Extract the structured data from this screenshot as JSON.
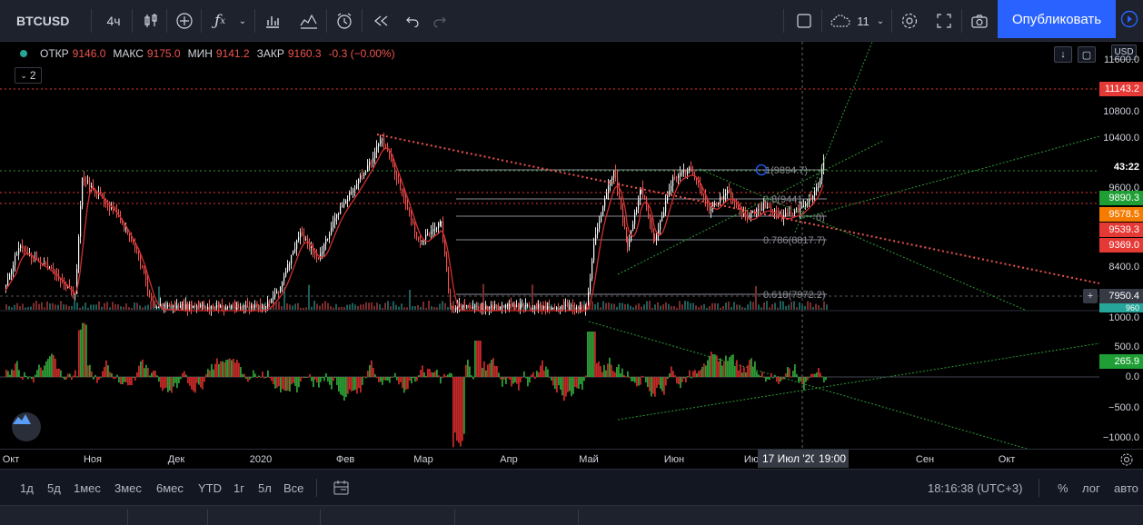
{
  "toolbar": {
    "symbol": "BTCUSD",
    "interval": "4ч",
    "layouts_count": "11",
    "publish_label": "Опубликовать",
    "icons": [
      "candles-icon",
      "add-indicator-icon",
      "fx-icon",
      "chevron-down-icon",
      "compare-icon",
      "bars-icon",
      "alert-icon",
      "replay-icon",
      "undo-icon",
      "redo-icon",
      "layout-icon",
      "cloud-icon",
      "settings-icon",
      "fullscreen-icon",
      "camera-icon",
      "play-icon"
    ]
  },
  "legend": {
    "open_label": "ОТКР",
    "open": "9146.0",
    "high_label": "МАКС",
    "high": "9175.0",
    "low_label": "МИН",
    "low": "9141.2",
    "close_label": "ЗАКР",
    "close": "9160.3",
    "change": "-0.3 (−0.00%)",
    "collapse_count": "2",
    "currency": "USD"
  },
  "colors": {
    "up": "#26a69a",
    "down": "#ef5350",
    "green_ind": "#2e9c35",
    "red_ind": "#c62828",
    "accent": "#2962ff"
  },
  "price_axis": [
    "11600.0",
    "10800.0",
    "10400.0",
    "9600.0",
    "8400.0",
    "1000.0",
    "500.0",
    "0.0",
    "−500.0",
    "−1000.0"
  ],
  "price_tags": {
    "p11143": "11143.2",
    "countdown": "43:22",
    "p9890": "9890.3",
    "p9578": "9578.5",
    "p9539": "9539.3",
    "p9369": "9369.0",
    "p7950": "7950.4",
    "p960": "960",
    "ind_value": "265.9"
  },
  "fib_labels": {
    "f1": "1(9894.7)",
    "f2": "0.8(9441",
    "f3": "0.786(8817.7)",
    "f4": "0.618(7972.2)",
    "f5": "0)"
  },
  "time_axis": [
    "Окт",
    "Ноя",
    "Дек",
    "2020",
    "Фев",
    "Мар",
    "Апр",
    "Май",
    "Июн",
    "Ию",
    "Сен",
    "Окт"
  ],
  "crosshair": {
    "date": "17 Июл '20",
    "time": "19:00"
  },
  "ranges": [
    "1д",
    "5д",
    "1мес",
    "3мес",
    "6мес",
    "YTD",
    "1г",
    "5л",
    "Все"
  ],
  "clock": "18:16:38 (UTC+3)",
  "scale_opts": {
    "percent": "%",
    "log": "лог",
    "auto": "авто"
  }
}
